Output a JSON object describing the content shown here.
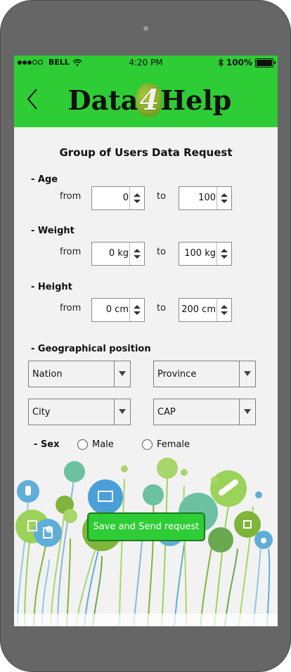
{
  "status_bar": {
    "carrier": "BELL",
    "time": "4:20 PM",
    "battery": "100%",
    "signal_icon": "signal-dots-icon",
    "wifi_icon": "wifi-icon",
    "bluetooth_icon": "bluetooth-icon",
    "battery_icon": "battery-icon"
  },
  "header": {
    "back_icon": "chevron-left-icon",
    "logo_part1": "Data",
    "logo_part2": "4",
    "logo_part3": "Help",
    "accent_color": "#2ecc35"
  },
  "form": {
    "title": "Group of Users Data Request",
    "age": {
      "label": "- Age",
      "from_label": "from",
      "to_label": "to",
      "from_value": "0",
      "to_value": "100"
    },
    "weight": {
      "label": "- Weight",
      "from_label": "from",
      "to_label": "to",
      "from_value": "0 kg",
      "to_value": "100 kg"
    },
    "height": {
      "label": "- Height",
      "from_label": "from",
      "to_label": "to",
      "from_value": "0 cm",
      "to_value": "200 cm"
    },
    "geo": {
      "label": "- Geographical position",
      "nation": "Nation",
      "province": "Province",
      "city": "City",
      "cap": "CAP"
    },
    "sex": {
      "label": "- Sex",
      "male": "Male",
      "female": "Female"
    },
    "submit_label": "Save and Send request"
  }
}
